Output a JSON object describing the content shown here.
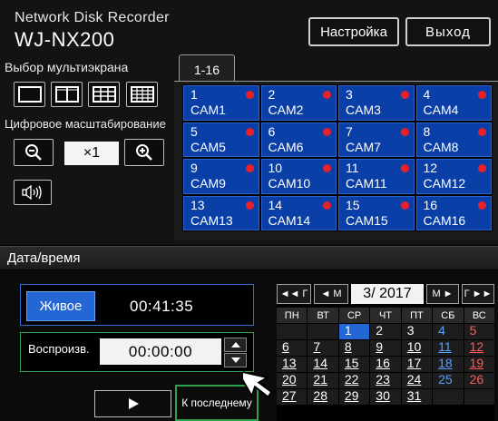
{
  "header": {
    "brand_line": "Network Disk Recorder",
    "model": "WJ-NX200",
    "settings_label": "Настройка",
    "exit_label": "Выход"
  },
  "multiscreen": {
    "label": "Выбор мультиэкрана",
    "layouts": [
      "1-screen-icon",
      "4-screen-icon",
      "9-screen-icon",
      "16-screen-icon"
    ]
  },
  "digital_zoom": {
    "label": "Цифровое масштабирование",
    "value": "×1"
  },
  "camera_tab": {
    "label": "1-16"
  },
  "cameras": [
    {
      "num": "1",
      "name": "CAM1"
    },
    {
      "num": "2",
      "name": "CAM2"
    },
    {
      "num": "3",
      "name": "CAM3"
    },
    {
      "num": "4",
      "name": "CAM4"
    },
    {
      "num": "5",
      "name": "CAM5"
    },
    {
      "num": "6",
      "name": "CAM6"
    },
    {
      "num": "7",
      "name": "CAM7"
    },
    {
      "num": "8",
      "name": "CAM8"
    },
    {
      "num": "9",
      "name": "CAM9"
    },
    {
      "num": "10",
      "name": "CAM10"
    },
    {
      "num": "11",
      "name": "CAM11"
    },
    {
      "num": "12",
      "name": "CAM12"
    },
    {
      "num": "13",
      "name": "CAM13"
    },
    {
      "num": "14",
      "name": "CAM14"
    },
    {
      "num": "15",
      "name": "CAM15"
    },
    {
      "num": "16",
      "name": "CAM16"
    }
  ],
  "datetime": {
    "section_label": "Дата/время",
    "live_label": "Живое",
    "live_time": "00:41:35",
    "playback_label": "Воспроизв.",
    "playback_time": "00:00:00",
    "go_last_label": "К последнему"
  },
  "calendar": {
    "nav_year_back": "◄◄ Г",
    "nav_month_back": "◄ М",
    "month": "3/ 2017",
    "nav_month_fwd": "М ►",
    "nav_year_fwd": "Г ►►",
    "weekdays": [
      "ПН",
      "ВТ",
      "СР",
      "ЧТ",
      "ПТ",
      "СБ",
      "ВС"
    ],
    "cells": [
      "",
      "",
      "1",
      "2",
      "3",
      "4",
      "5",
      "6",
      "7",
      "8",
      "9",
      "10",
      "11",
      "12",
      "13",
      "14",
      "15",
      "16",
      "17",
      "18",
      "19",
      "20",
      "21",
      "22",
      "23",
      "24",
      "25",
      "26",
      "27",
      "28",
      "29",
      "30",
      "31",
      "",
      ""
    ],
    "selected_day": "1"
  },
  "colors": {
    "camera_tile": "#0b3fa8",
    "live_accent": "#2466d4",
    "playback_accent": "#2fa04a",
    "record_dot": "#e8202a"
  }
}
